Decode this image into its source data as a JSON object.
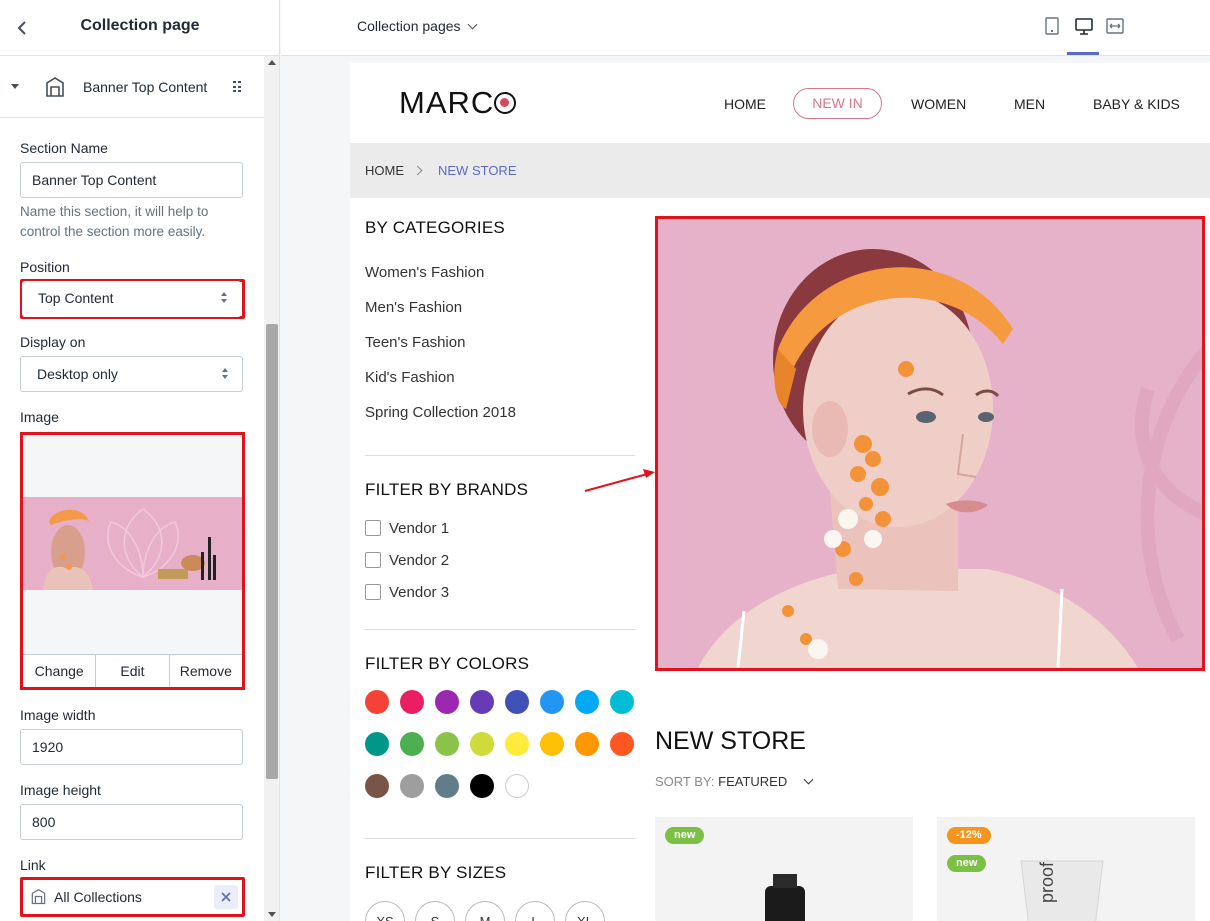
{
  "sidebar": {
    "title": "Collection page",
    "section_name": "Banner Top Content",
    "fields": {
      "section_name_label": "Section Name",
      "section_name_value": "Banner Top Content",
      "section_name_help": "Name this section, it will help to control the section more easily.",
      "position_label": "Position",
      "position_value": "Top Content",
      "display_label": "Display on",
      "display_value": "Desktop only",
      "image_label": "Image",
      "image_actions": [
        "Change",
        "Edit",
        "Remove"
      ],
      "image_width_label": "Image width",
      "image_width_value": "1920",
      "image_height_label": "Image height",
      "image_height_value": "800",
      "link_label": "Link",
      "link_value": "All Collections"
    }
  },
  "topbar": {
    "template_select": "Collection pages",
    "devices": [
      "mobile-icon",
      "desktop-icon",
      "full-width-icon"
    ],
    "active_device": "desktop"
  },
  "store": {
    "logo": "MARC",
    "nav": [
      "HOME",
      "NEW IN",
      "WOMEN",
      "MEN",
      "BABY & KIDS"
    ],
    "breadcrumb": {
      "home": "HOME",
      "current": "NEW STORE"
    },
    "categories_heading": "BY CATEGORIES",
    "categories": [
      "Women's Fashion",
      "Men's Fashion",
      "Teen's Fashion",
      "Kid's Fashion",
      "Spring Collection 2018"
    ],
    "brands_heading": "FILTER BY BRANDS",
    "brands": [
      "Vendor 1",
      "Vendor 2",
      "Vendor 3"
    ],
    "colors_heading": "FILTER BY COLORS",
    "colors": [
      "#f44336",
      "#e91e63",
      "#9c27b0",
      "#673ab7",
      "#3f51b5",
      "#2196f3",
      "#03a9f4",
      "#00bcd4",
      "#009688",
      "#4caf50",
      "#8bc34a",
      "#cddc39",
      "#ffeb3b",
      "#ffc107",
      "#ff9800",
      "#ff5722",
      "#795548",
      "#9e9e9e",
      "#607d8b",
      "#000000",
      "#ffffff"
    ],
    "sizes_heading": "FILTER BY SIZES",
    "sizes": [
      "XS",
      "S",
      "M",
      "L",
      "XL"
    ],
    "main_title": "NEW STORE",
    "sort_label": "SORT BY:",
    "sort_value": "FEATURED",
    "products": [
      {
        "badges": [
          "new"
        ]
      },
      {
        "badges": [
          "-12%",
          "new"
        ],
        "product_text": "proof"
      }
    ]
  },
  "accent_colors": {
    "selection_red": "#e1121b",
    "nav_pink": "#d6788a",
    "banner_pink": "#e8b0c8",
    "link_blue": "#5c6ac4"
  }
}
